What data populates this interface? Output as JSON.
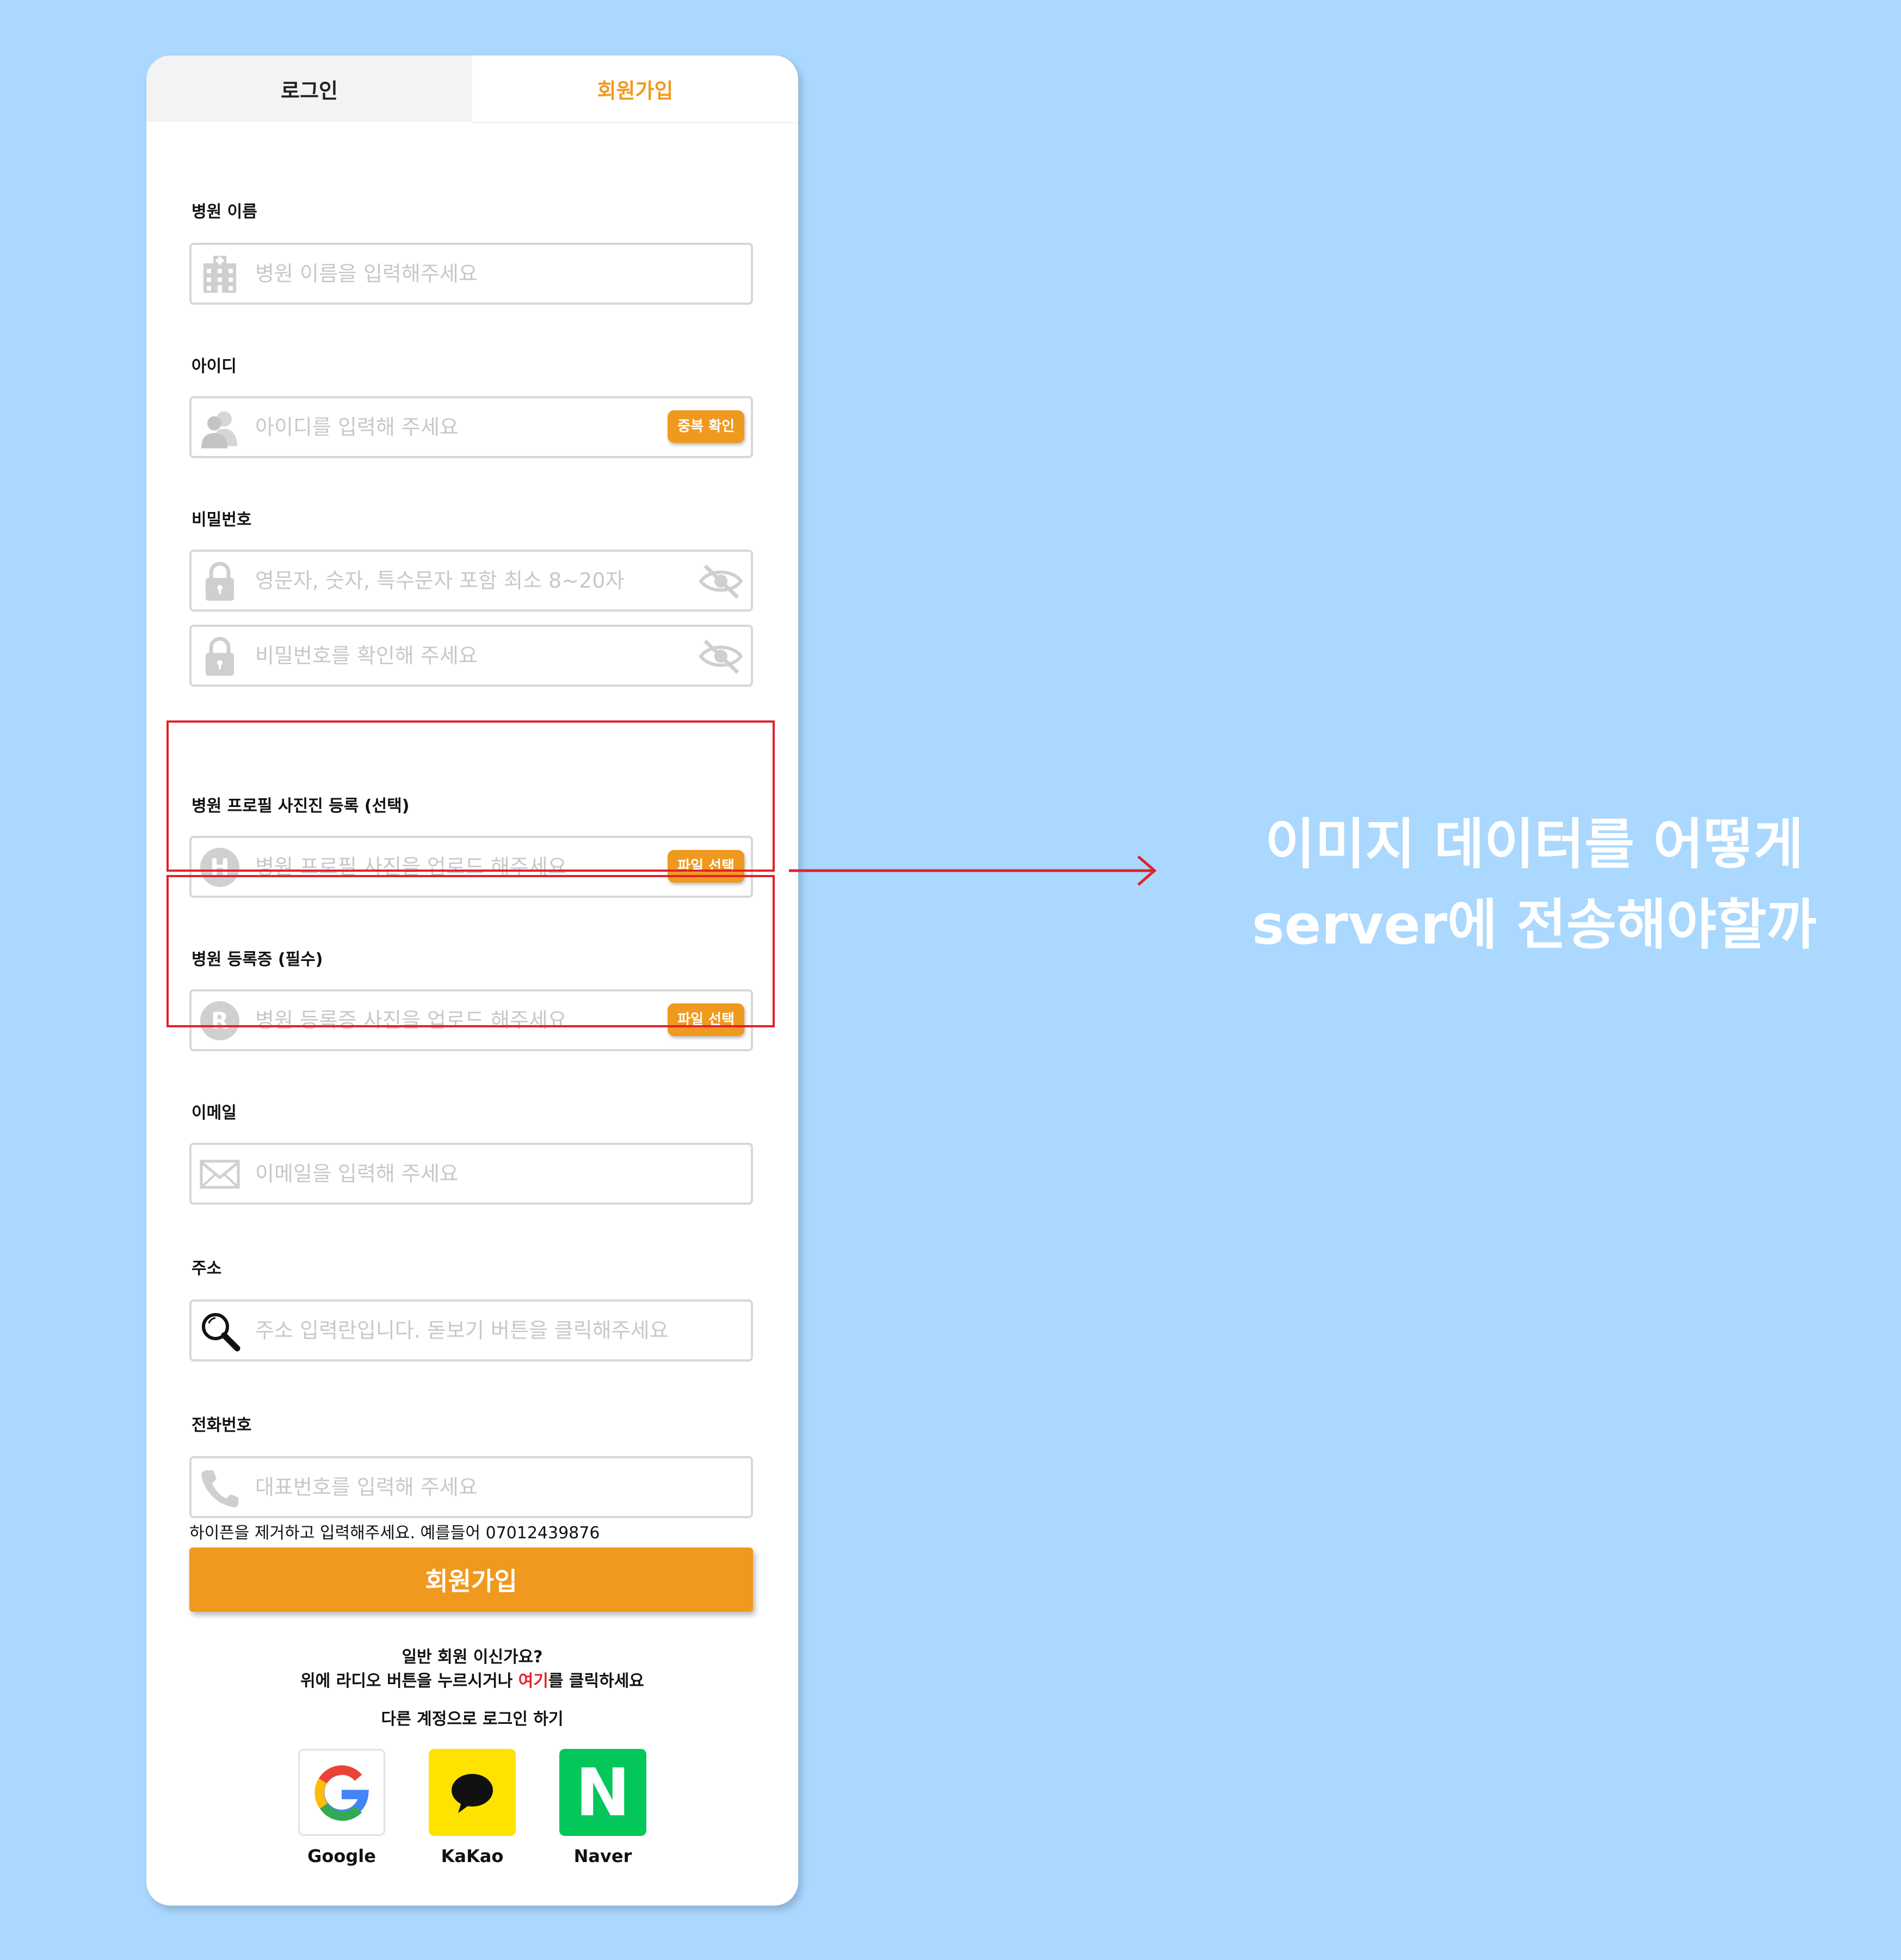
{
  "tabs": {
    "login": "로그인",
    "signup": "회원가입"
  },
  "fields": {
    "hospital_name": {
      "label": "병원 이름",
      "placeholder": "병원 이름을 입력해주세요"
    },
    "user_id": {
      "label": "아이디",
      "placeholder": "아이디를 입력해 주세요",
      "button": "중복 확인"
    },
    "password": {
      "label": "비밀번호",
      "placeholder": "영문자, 숫자, 특수문자 포함 최소 8~20자",
      "confirm_placeholder": "비밀번호를 확인해 주세요"
    },
    "profile_photo": {
      "label": "병원 프로필 사진진 등록 (선택)",
      "placeholder": "병원 프로필 사진을 업로드 해주세요",
      "button": "파일 선택",
      "icon_letter": "H"
    },
    "registration": {
      "label": "병원 등록증 (필수)",
      "placeholder": "병원 등록증 사진을 업로드 해주세요",
      "button": "파일 선택",
      "icon_letter": "R"
    },
    "email": {
      "label": "이메일",
      "placeholder": "이메일을 입력해 주세요"
    },
    "address": {
      "label": "주소",
      "placeholder": "주소 입력란입니다. 돋보기 버튼을 클릭해주세요"
    },
    "phone": {
      "label": "전화번호",
      "placeholder": "대표번호를 입력해 주세요",
      "hint": "하이픈을 제거하고 입력해주세요. 예를들어 07012439876"
    }
  },
  "submit_label": "회원가입",
  "general": {
    "question": "일반 회원 이신가요?",
    "line_pre": "위에 라디오 버튼을 누르시거나 ",
    "link": "여기",
    "line_post": "를 클릭하세요",
    "other_login": "다른 계정으로 로그인 하기"
  },
  "social": [
    {
      "name": "Google",
      "icon": "google-icon"
    },
    {
      "name": "KaKao",
      "icon": "kakao-icon"
    },
    {
      "name": "Naver",
      "icon": "naver-icon",
      "letter": "N"
    }
  ],
  "annotation": {
    "line1": "이미지 데이터를 어떻게",
    "line2": "server에 전송해야할까"
  },
  "colors": {
    "accent": "#f0991f",
    "background": "#aad8fe",
    "highlight": "#e3202a",
    "kakao": "#ffe300",
    "naver": "#03c75a"
  }
}
